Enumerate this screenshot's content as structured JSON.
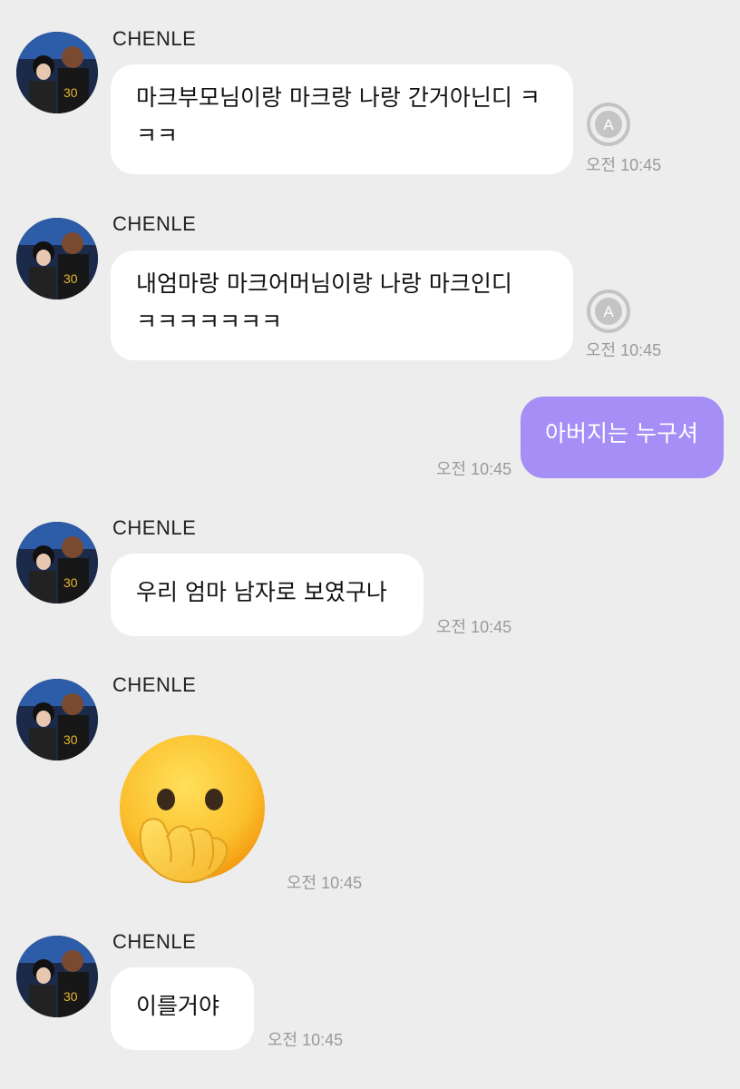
{
  "sender_name": "CHENLE",
  "messages": [
    {
      "text": "마크부모님이랑 마크랑 나랑 간거아닌디 ㅋㅋㅋ",
      "line1": "마크부모님이랑 마크랑 나랑 간거아닌디 ㅋ",
      "line2": "ㅋㅋ",
      "time": "오전 10:45"
    },
    {
      "text": "내엄마랑 마크어머님이랑 나랑 마크인디 ㅋㅋㅋㅋㅋㅋㅋ",
      "line1": "내엄마랑 마크어머님이랑 나랑 마크인디",
      "line2": "ㅋㅋㅋㅋㅋㅋㅋ",
      "time": "오전 10:45"
    },
    {
      "text": "아버지는 누구셔",
      "time": "오전 10:45"
    },
    {
      "text": "우리 엄마 남자로 보였구나",
      "time": "오전 10:45"
    },
    {
      "emoji": "face-with-hand-over-mouth",
      "time": "오전 10:45"
    },
    {
      "text": "이를거야",
      "time": "오전 10:45"
    }
  ],
  "colors": {
    "background": "#ededed",
    "incoming_bubble": "#ffffff",
    "outgoing_bubble": "#a58ef5",
    "timestamp": "#9a9a9a",
    "translate_icon": "#bdbdbd"
  },
  "icons": {
    "translate": "translate-a-icon",
    "avatar": "profile-photo"
  }
}
